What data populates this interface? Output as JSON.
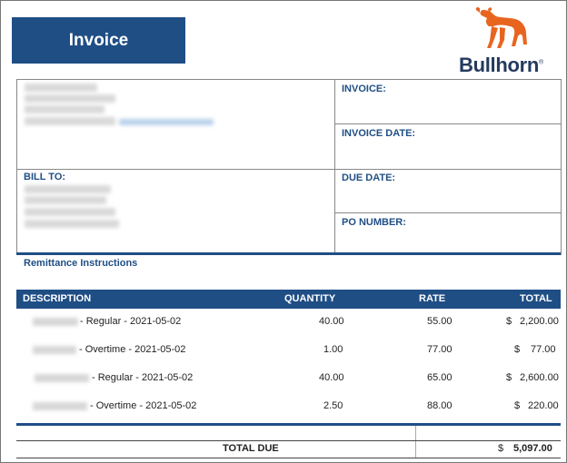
{
  "header": {
    "title": "Invoice",
    "logo_text": "Bullhorn"
  },
  "colors": {
    "brand_blue": "#1f4e85",
    "logo_orange": "#e8651f"
  },
  "info": {
    "invoice_label": "INVOICE:",
    "invoice_date_label": "INVOICE DATE:",
    "bill_to_label": "BILL TO:",
    "due_date_label": "DUE DATE:",
    "po_number_label": "PO NUMBER:"
  },
  "remittance": "Remittance Instructions",
  "table": {
    "headers": {
      "description": "DESCRIPTION",
      "quantity": "QUANTITY",
      "rate": "RATE",
      "total": "TOTAL"
    },
    "rows": [
      {
        "description": "- Regular - 2021-05-02",
        "quantity": "40.00",
        "rate": "55.00",
        "currency": "$",
        "total": "2,200.00"
      },
      {
        "description": "- Overtime - 2021-05-02",
        "quantity": "1.00",
        "rate": "77.00",
        "currency": "$",
        "total": "77.00"
      },
      {
        "description": "- Regular - 2021-05-02",
        "quantity": "40.00",
        "rate": "65.00",
        "currency": "$",
        "total": "2,600.00"
      },
      {
        "description": "- Overtime - 2021-05-02",
        "quantity": "2.50",
        "rate": "88.00",
        "currency": "$",
        "total": "220.00"
      }
    ]
  },
  "total_due": {
    "label": "TOTAL DUE",
    "currency": "$",
    "value": "5,097.00"
  }
}
